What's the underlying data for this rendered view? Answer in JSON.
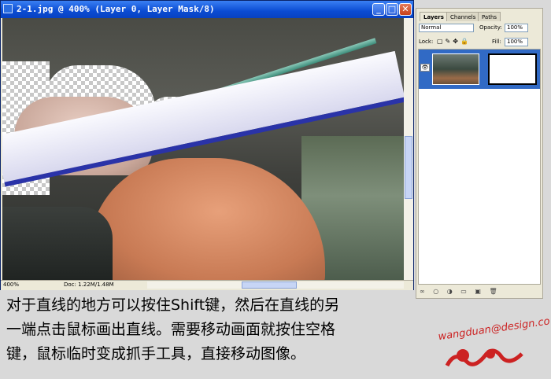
{
  "window": {
    "title": "2-1.jpg @ 400% (Layer 0, Layer Mask/8)",
    "min_glyph": "_",
    "max_glyph": "□",
    "close_glyph": "✕"
  },
  "status": {
    "zoom": "400%",
    "doc_info": "Doc: 1.22M/1.48M"
  },
  "palette": {
    "tabs": [
      "Layers",
      "Channels",
      "Paths"
    ],
    "blend_mode": "Normal",
    "opacity_label": "Opacity:",
    "opacity_value": "100%",
    "lock_label": "Lock:",
    "fill_label": "Fill:",
    "fill_value": "100%",
    "bottom_icons": "∞ ○ ◑ ▭ ▣ 🗑"
  },
  "caption": {
    "line1": "对于直线的地方可以按住Shift键，然后在直线的另",
    "line2": "一端点击鼠标画出直线。需要移动画面就按住空格",
    "line3": "键，鼠标临时变成抓手工具，直接移动图像。"
  },
  "logo": {
    "text": "wangduan@design.com"
  },
  "colors": {
    "title_bar": "#0a4bd3",
    "selected_layer": "#316ac5",
    "logo_red": "#cc2222"
  }
}
